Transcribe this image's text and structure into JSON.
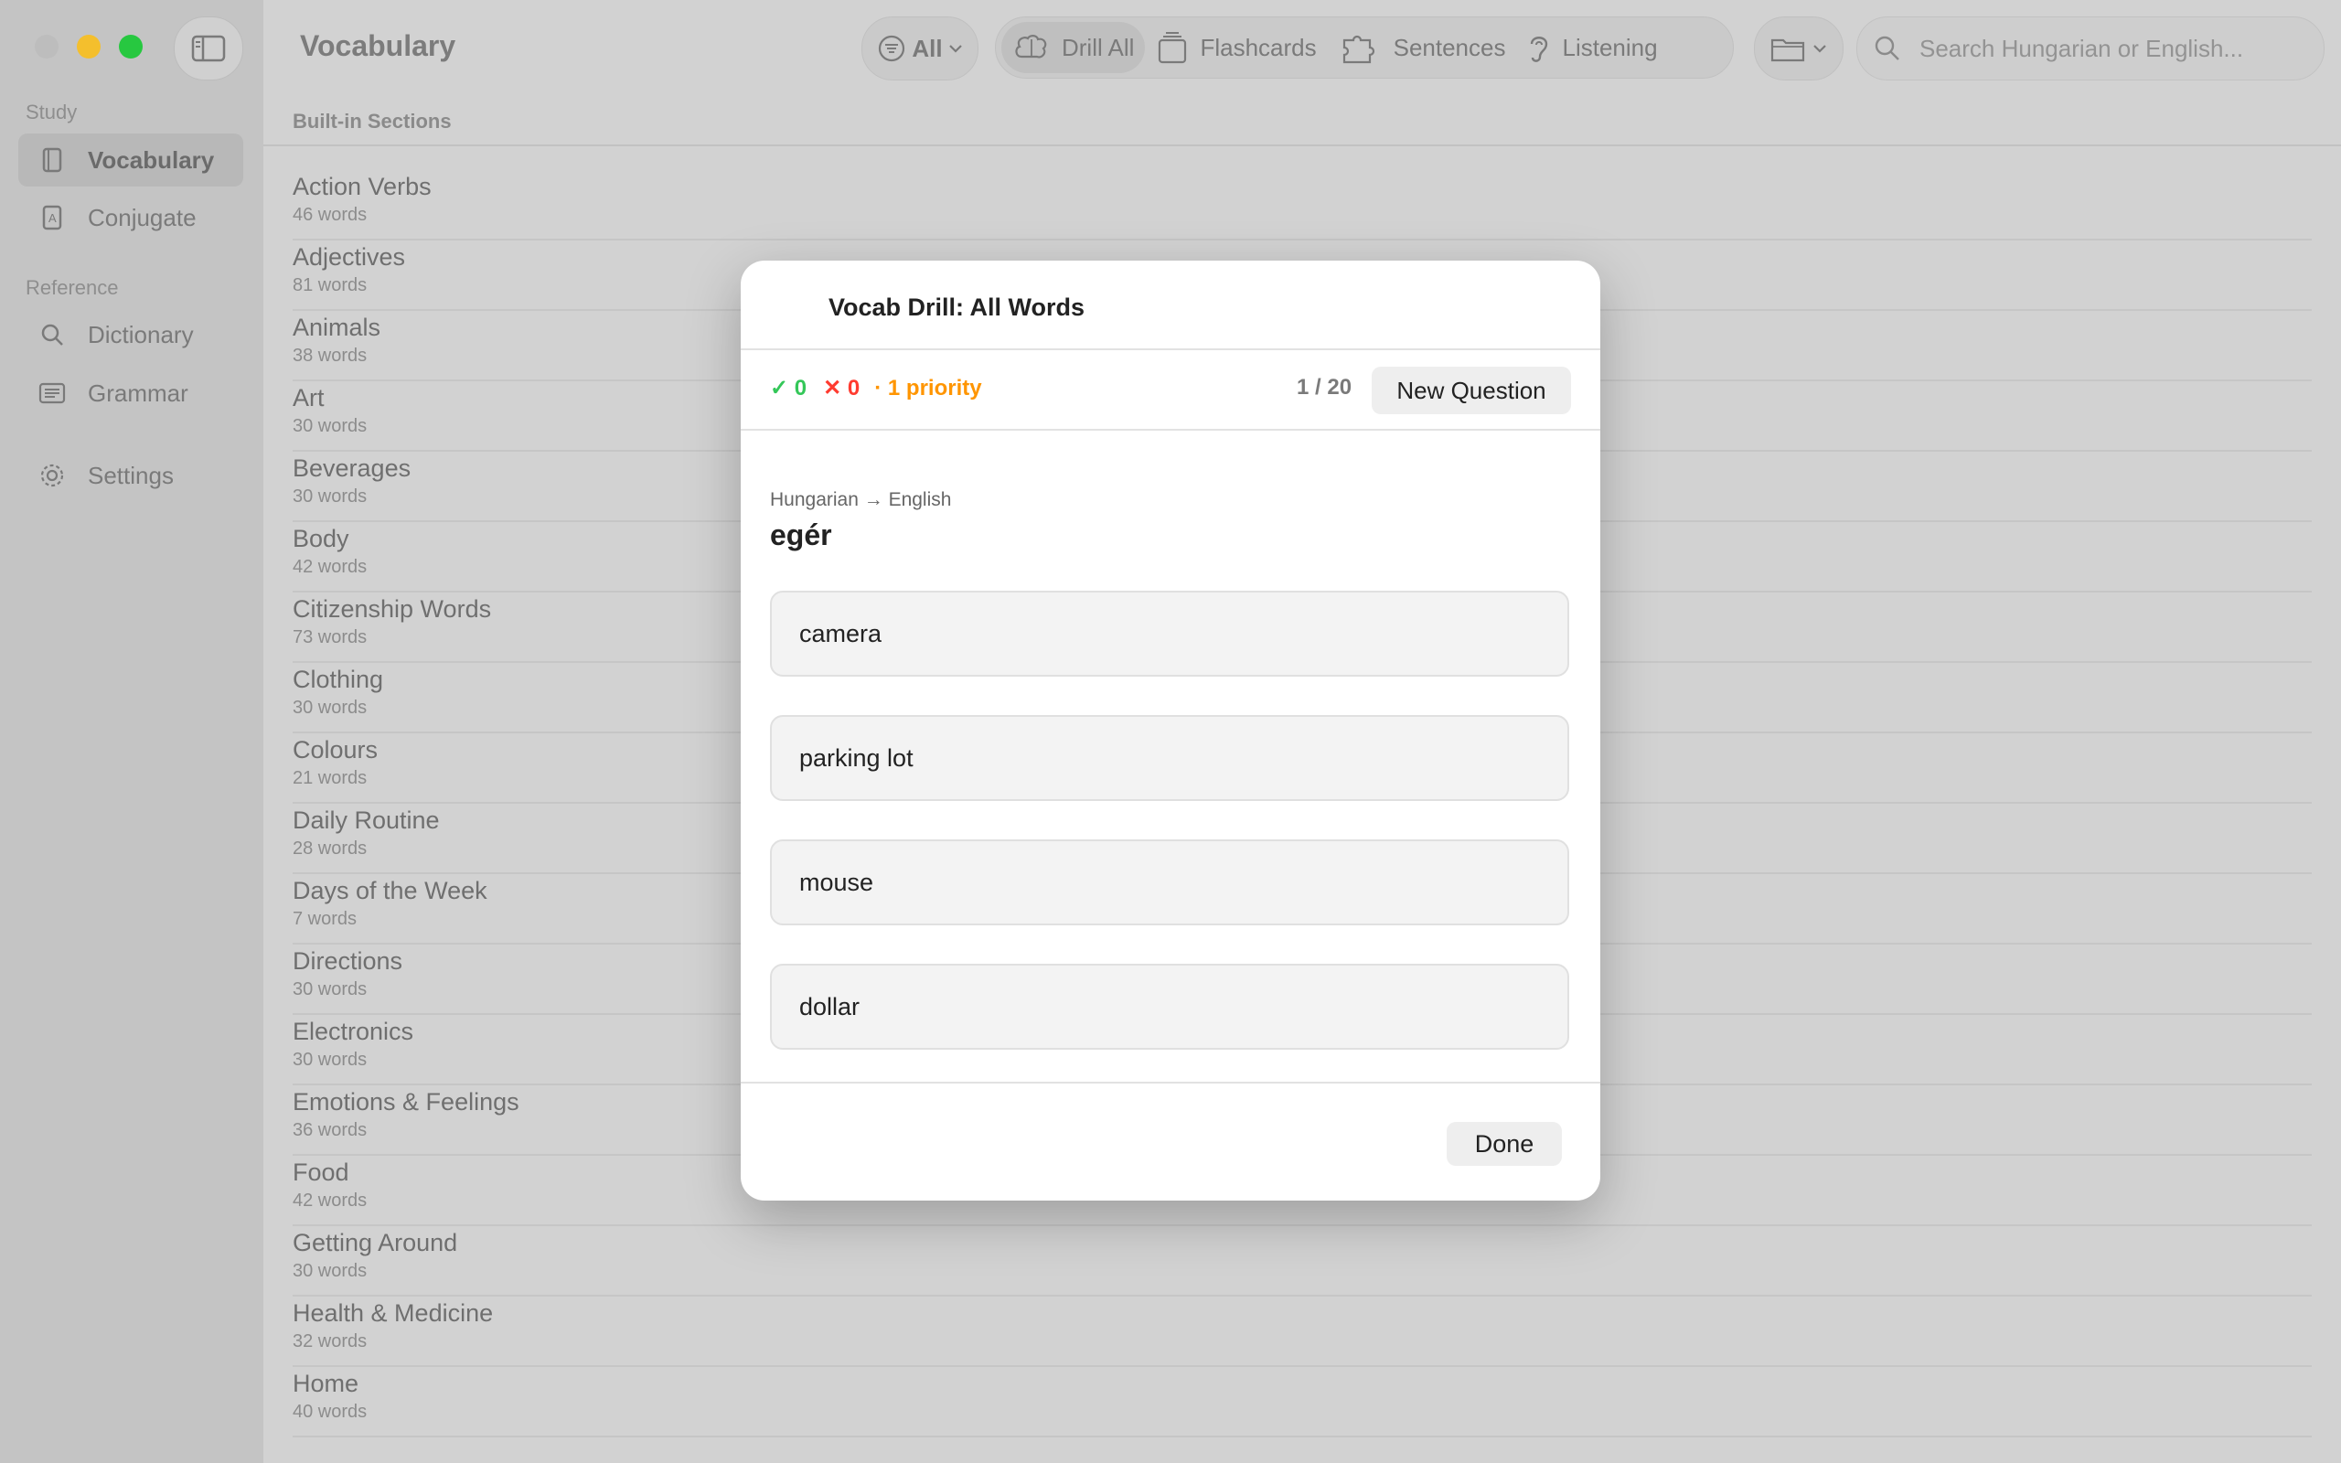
{
  "window": {
    "title": "Vocabulary"
  },
  "sidebar": {
    "sections": [
      {
        "label": "Study",
        "items": [
          {
            "label": "Vocabulary",
            "icon": "book-icon",
            "active": true
          },
          {
            "label": "Conjugate",
            "icon": "conjugate-icon"
          }
        ]
      },
      {
        "label": "Reference",
        "items": [
          {
            "label": "Dictionary",
            "icon": "search-icon"
          },
          {
            "label": "Grammar",
            "icon": "grammar-icon"
          },
          {
            "label": "Settings",
            "icon": "gear-icon"
          }
        ]
      }
    ]
  },
  "toolbar": {
    "filter_label": "All",
    "drill_all": "Drill All",
    "flashcards": "Flashcards",
    "sentences": "Sentences",
    "listening": "Listening",
    "search_placeholder": "Search Hungarian or English..."
  },
  "list": {
    "section_title": "Built-in Sections",
    "rows": [
      {
        "title": "Action Verbs",
        "sub": "46 words"
      },
      {
        "title": "Adjectives",
        "sub": "81 words"
      },
      {
        "title": "Animals",
        "sub": "38 words"
      },
      {
        "title": "Art",
        "sub": "30 words"
      },
      {
        "title": "Beverages",
        "sub": "30 words"
      },
      {
        "title": "Body",
        "sub": "42 words"
      },
      {
        "title": "Citizenship Words",
        "sub": "73 words"
      },
      {
        "title": "Clothing",
        "sub": "30 words"
      },
      {
        "title": "Colours",
        "sub": "21 words"
      },
      {
        "title": "Daily Routine",
        "sub": "28 words"
      },
      {
        "title": "Days of the Week",
        "sub": "7 words"
      },
      {
        "title": "Directions",
        "sub": "30 words"
      },
      {
        "title": "Electronics",
        "sub": "30 words"
      },
      {
        "title": "Emotions & Feelings",
        "sub": "36 words"
      },
      {
        "title": "Food",
        "sub": "42 words"
      },
      {
        "title": "Getting Around",
        "sub": "30 words"
      },
      {
        "title": "Health & Medicine",
        "sub": "32 words"
      },
      {
        "title": "Home",
        "sub": "40 words"
      }
    ]
  },
  "modal": {
    "title": "Vocab Drill: All Words",
    "correct": "✓ 0",
    "wrong": "✕ 0",
    "priority": "· 1 priority",
    "counter": "1 / 20",
    "new_question": "New Question",
    "direction": "Hungarian → English",
    "word": "egér",
    "answers": [
      "camera",
      "parking lot",
      "mouse",
      "dollar"
    ],
    "done": "Done"
  },
  "colors": {
    "correct": "#34c759",
    "wrong": "#ff3b30",
    "priority": "#ff9500"
  }
}
